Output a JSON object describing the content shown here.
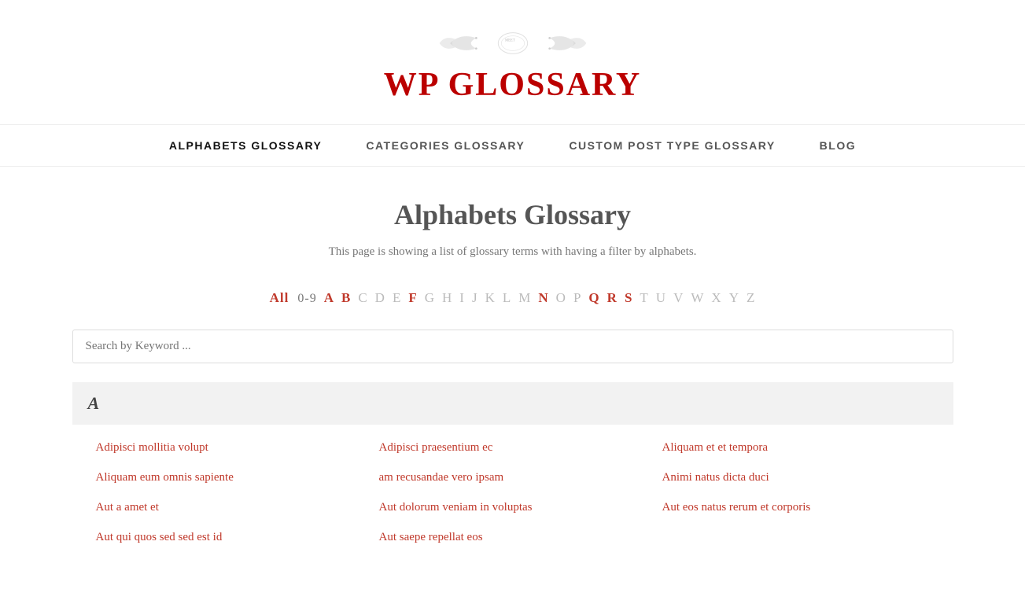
{
  "header": {
    "meet_text": "MEET",
    "logo_text": "WP GLOSSARY",
    "ornament_text": "❧ ✦ ❧"
  },
  "nav": {
    "items": [
      {
        "label": "ALPHABETS GLOSSARY",
        "active": true,
        "id": "alphabets"
      },
      {
        "label": "CATEGORIES GLOSSARY",
        "active": false,
        "id": "categories"
      },
      {
        "label": "CUSTOM POST TYPE GLOSSARY",
        "active": false,
        "id": "custom-post"
      },
      {
        "label": "BLOG",
        "active": false,
        "id": "blog"
      }
    ]
  },
  "page": {
    "title": "Alphabets Glossary",
    "description": "This page is showing a list of glossary terms with having a filter by alphabets."
  },
  "alphabet_filter": {
    "all_label": "All",
    "numbers": "0-9",
    "letters_bold": [
      "A",
      "B",
      "N",
      "Q",
      "R",
      "S"
    ],
    "letters": [
      "A",
      "B",
      "C",
      "D",
      "E",
      "F",
      "G",
      "H",
      "I",
      "J",
      "K",
      "L",
      "M",
      "N",
      "O",
      "P",
      "Q",
      "R",
      "S",
      "T",
      "U",
      "V",
      "W",
      "X",
      "Y",
      "Z"
    ]
  },
  "search": {
    "placeholder": "Search by Keyword ..."
  },
  "sections": [
    {
      "letter": "A",
      "items": [
        "Adipisci mollitia volupt",
        "Adipisci praesentium ec",
        "Aliquam et et tempora",
        "Aliquam eum omnis sapiente",
        "am recusandae vero ipsam",
        "Animi natus dicta duci",
        "Aut a amet et",
        "Aut dolorum veniam in voluptas",
        "Aut eos natus rerum et corporis",
        "Aut qui quos sed sed est id",
        "Aut saepe repellat eos",
        ""
      ]
    }
  ]
}
